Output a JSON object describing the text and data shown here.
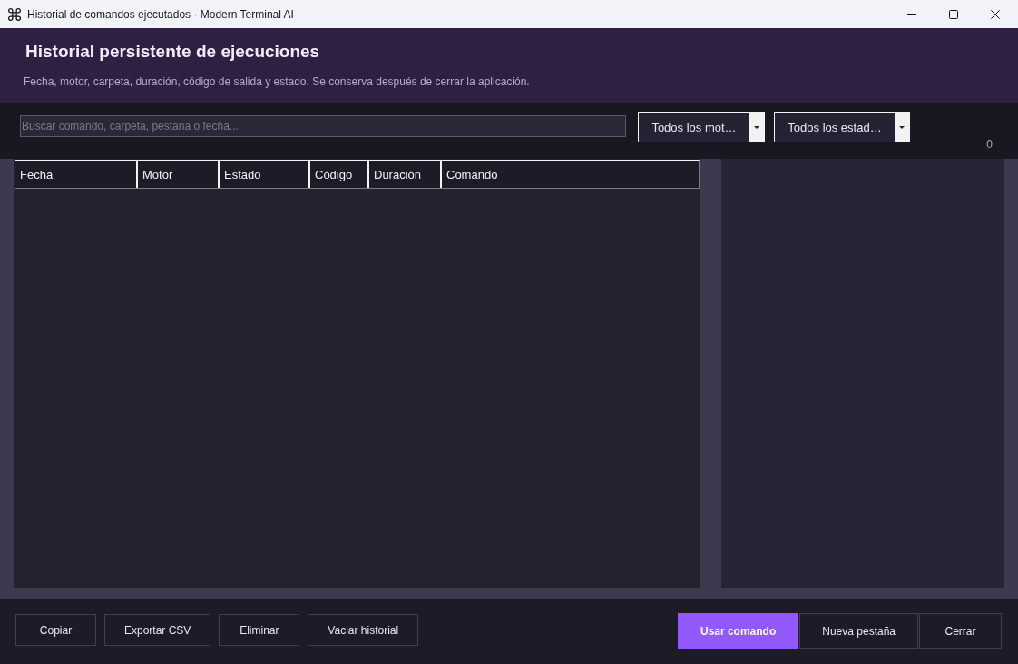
{
  "window": {
    "title": "Historial de comandos ejecutados · Modern Terminal AI"
  },
  "header": {
    "title": "Historial persistente de ejecuciones",
    "subtitle": "Fecha, motor, carpeta, duración, código de salida y estado. Se conserva después de cerrar la aplicación."
  },
  "filters": {
    "search": {
      "placeholder": "Buscar comando, carpeta, pestaña o fecha..."
    },
    "engine_filter": {
      "value": "Todos los mot…"
    },
    "status_filter": {
      "value": "Todos los estad…"
    },
    "count": "0"
  },
  "table": {
    "columns": [
      "Fecha",
      "Motor",
      "Estado",
      "Código",
      "Duración",
      "Comando"
    ]
  },
  "actions": {
    "left": [
      {
        "label": "Copiar",
        "kind": "normal"
      },
      {
        "label": "Exportar CSV",
        "kind": "normal"
      },
      {
        "label": "Eliminar",
        "kind": "normal"
      },
      {
        "label": "Vaciar historial",
        "kind": "normal"
      }
    ],
    "right": [
      {
        "label": "Usar comando",
        "kind": "primary"
      },
      {
        "label": "Nueva pestaña",
        "kind": "normal"
      },
      {
        "label": "Cerrar",
        "kind": "normal"
      }
    ]
  }
}
